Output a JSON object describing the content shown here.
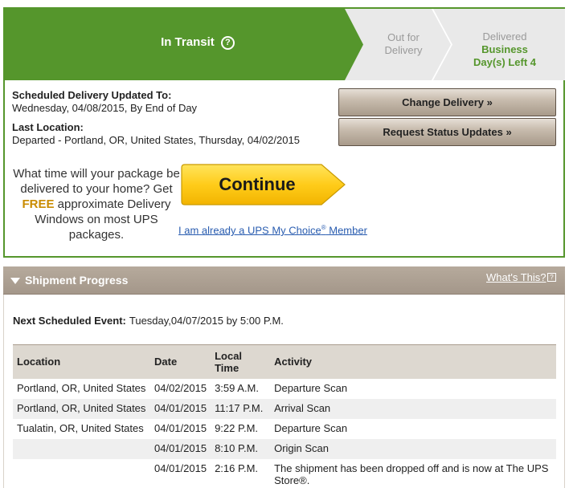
{
  "tracker": {
    "current_stage": "In Transit",
    "help_glyph": "?",
    "next_stage": [
      "Out for",
      "Delivery"
    ],
    "final_stage": "Delivered",
    "days_left": [
      "Business",
      "Day(s) Left 4"
    ],
    "colors": {
      "accent_green": "#55962c",
      "inactive_gray": "#e9e9e9"
    }
  },
  "schedule": {
    "title": "Scheduled Delivery Updated To:",
    "value": "Wednesday, 04/08/2015, By End of Day"
  },
  "last_location": {
    "title": "Last Location:",
    "value": "Departed - Portland, OR, United States, Thursday, 04/02/2015"
  },
  "buttons": {
    "change_delivery": "Change Delivery »",
    "request_updates": "Request Status Updates »",
    "continue": "Continue"
  },
  "promo": {
    "line1": "What time will your package be delivered to your home? Get",
    "free": "FREE",
    "line2": "approximate Delivery Windows on most UPS packages.",
    "member_link": "I am already a UPS My Choice",
    "member_link_reg": "®",
    "member_link_tail": " Member"
  },
  "progress": {
    "title": "Shipment Progress",
    "whats_this": "What's This?",
    "whats_icon": "?",
    "next_event_label": "Next Scheduled Event:",
    "next_event_value": "Tuesday,04/07/2015 by 5:00 P.M.",
    "columns": [
      "Location",
      "Date",
      "Local Time",
      "Activity"
    ],
    "rows": [
      {
        "location": "Portland, OR, United States",
        "date": "04/02/2015",
        "time": "3:59 A.M.",
        "activity": "Departure Scan"
      },
      {
        "location": "Portland, OR, United States",
        "date": "04/01/2015",
        "time": "11:17 P.M.",
        "activity": "Arrival Scan"
      },
      {
        "location": "Tualatin, OR, United States",
        "date": "04/01/2015",
        "time": "9:22 P.M.",
        "activity": "Departure Scan"
      },
      {
        "location": "",
        "date": "04/01/2015",
        "time": "8:10 P.M.",
        "activity": "Origin Scan"
      },
      {
        "location": "",
        "date": "04/01/2015",
        "time": "2:16 P.M.",
        "activity": "The shipment has been dropped off and is now at The UPS Store®."
      }
    ]
  }
}
